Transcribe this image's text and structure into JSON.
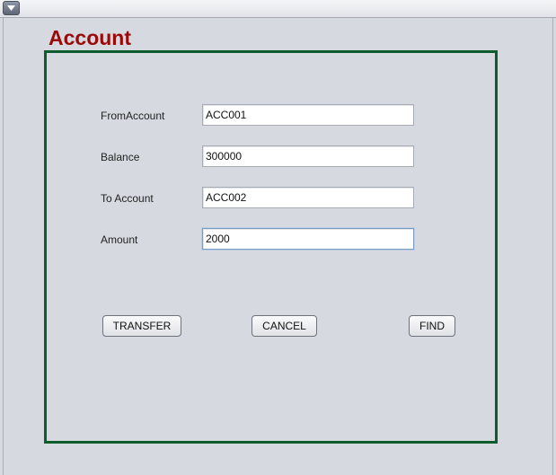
{
  "window": {
    "menu_icon": "chevron-down-icon"
  },
  "form": {
    "title": "Account",
    "fields": {
      "from_account": {
        "label": "FromAccount",
        "value": "ACC001"
      },
      "balance": {
        "label": "Balance",
        "value": "300000"
      },
      "to_account": {
        "label": "To Account",
        "value": "ACC002"
      },
      "amount": {
        "label": "Amount",
        "value": "2000"
      }
    },
    "buttons": {
      "transfer": "TRANSFER",
      "cancel": "CANCEL",
      "find": "FIND"
    }
  },
  "colors": {
    "title": "#9a0a0a",
    "panel_border": "#0d5c2c",
    "background": "#d6d9df"
  }
}
